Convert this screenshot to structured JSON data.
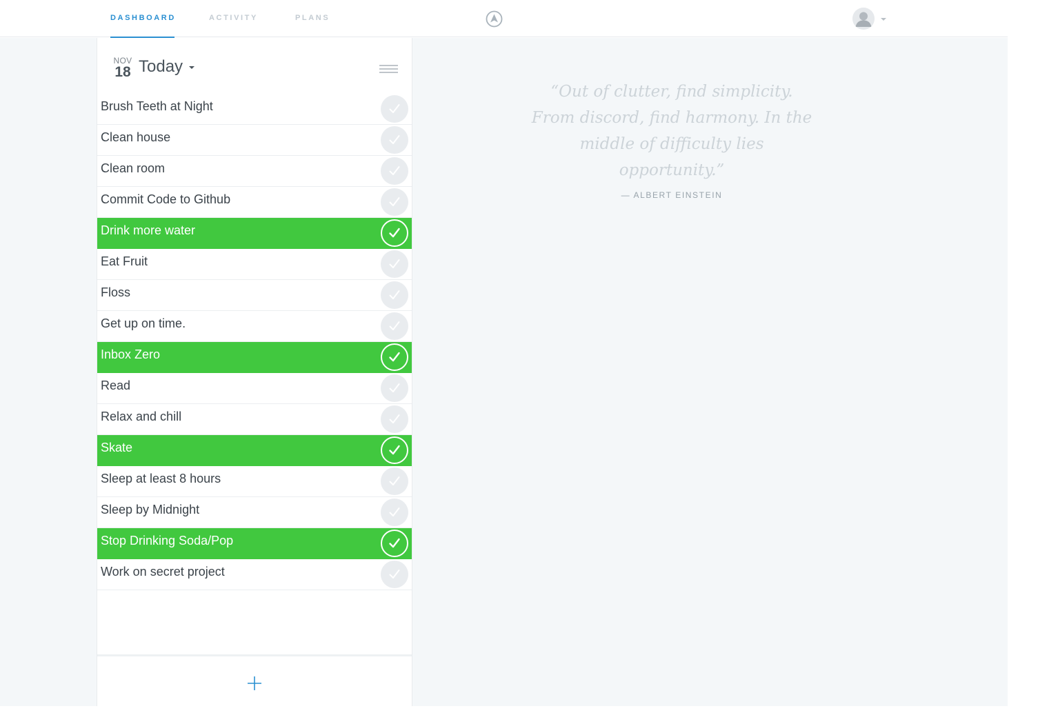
{
  "nav": {
    "tabs": [
      {
        "label": "DASHBOARD",
        "active": true
      },
      {
        "label": "ACTIVITY",
        "active": false
      },
      {
        "label": "PLANS",
        "active": false
      }
    ],
    "logo_icon": "compass-arrow-icon",
    "avatar_icon": "user-avatar-icon"
  },
  "panel": {
    "date": {
      "month": "NOV",
      "day": "18"
    },
    "period": "Today",
    "menu_icon": "hamburger-menu-icon",
    "habits": [
      {
        "name": "Brush Teeth at Night",
        "done": false
      },
      {
        "name": "Clean house",
        "done": false
      },
      {
        "name": "Clean room",
        "done": false
      },
      {
        "name": "Commit Code to Github",
        "done": false
      },
      {
        "name": "Drink more water",
        "done": true
      },
      {
        "name": "Eat Fruit",
        "done": false
      },
      {
        "name": "Floss",
        "done": false
      },
      {
        "name": "Get up on time.",
        "done": false
      },
      {
        "name": "Inbox Zero",
        "done": true
      },
      {
        "name": "Read",
        "done": false
      },
      {
        "name": "Relax and chill",
        "done": false
      },
      {
        "name": "Skate",
        "done": true
      },
      {
        "name": "Sleep at least 8 hours",
        "done": false
      },
      {
        "name": "Sleep by Midnight",
        "done": false
      },
      {
        "name": "Stop Drinking Soda/Pop",
        "done": true
      },
      {
        "name": "Work on secret project",
        "done": false
      }
    ],
    "add_icon": "plus-icon"
  },
  "quote": {
    "lines": [
      "“Out of clutter, find simplicity.",
      "From discord, find harmony. In the",
      "middle of difficulty lies",
      "opportunity.”"
    ],
    "author": "— ALBERT EINSTEIN"
  },
  "colors": {
    "accent": "#2a8fd1",
    "done_green": "#41c83f",
    "background": "#f4f7f9"
  }
}
